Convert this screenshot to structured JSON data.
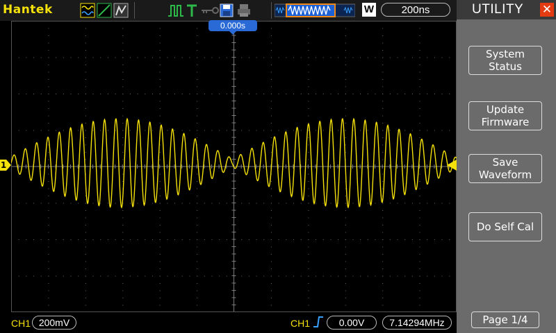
{
  "brand": "Hantek",
  "top": {
    "timebase": "200ns",
    "acquire_mode": "W",
    "trigger_position": "0.000s"
  },
  "bottom": {
    "ch1_label": "CH1",
    "ch1_scale": "200mV",
    "trig_source": "CH1",
    "trig_level": "0.00V",
    "frequency": "7.14294MHz"
  },
  "channel_marker": "1",
  "side": {
    "title": "UTILITY",
    "buttons": [
      {
        "line1": "System",
        "line2": "Status"
      },
      {
        "line1": "Update",
        "line2": "Firmware"
      },
      {
        "line1": "Save",
        "line2": "Waveform"
      },
      {
        "line1": "Do Self Cal",
        "line2": ""
      }
    ],
    "page": "Page 1/4"
  },
  "colors": {
    "trace": "#f5e10a",
    "accent_blue": "#2a6ad6",
    "close": "#e33b12"
  },
  "icons": [
    "waveform-icon",
    "slope-icon",
    "cursor-icon",
    "pulse-icon",
    "trigger-t-icon",
    "key-icon",
    "save-icon",
    "print-icon",
    "memory-depth-icon"
  ]
}
